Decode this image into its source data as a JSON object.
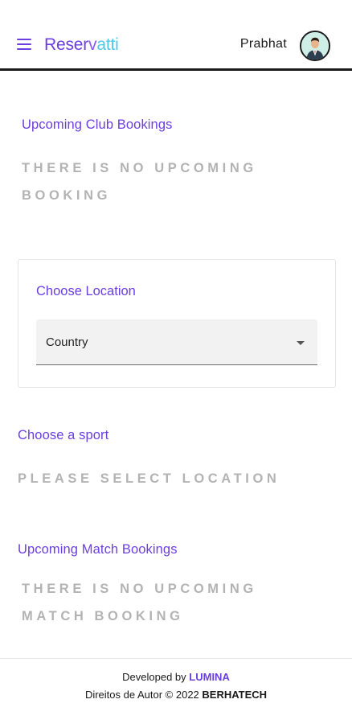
{
  "header": {
    "logo_part1": "Reser",
    "logo_part2": "v",
    "logo_part3": "atti",
    "username": "Prabhat",
    "menu_icon": "hamburger-menu-icon",
    "avatar_icon": "user-avatar"
  },
  "club_bookings": {
    "title": "Upcoming Club Bookings",
    "empty_line1": "THERE IS NO UPCOMING",
    "empty_line2": "BOOKING"
  },
  "location": {
    "title": "Choose Location",
    "select_value": "Country",
    "dropdown_icon": "caret-down-icon"
  },
  "sport": {
    "title": "Choose a sport",
    "empty": "PLEASE SELECT LOCATION"
  },
  "match_bookings": {
    "title": "Upcoming Match Bookings",
    "empty_line1": "THERE IS NO UPCOMING",
    "empty_line2": "MATCH BOOKING"
  },
  "footer": {
    "developed_prefix": "Developed by ",
    "developer": "LUMINA",
    "copyright_prefix": "Direitos de Autor © 2022 ",
    "company": "BERHATECH"
  },
  "colors": {
    "accent": "#6b3fe0",
    "muted_text": "#b3b3b3",
    "logo_cyan": "#4fc8e8"
  }
}
